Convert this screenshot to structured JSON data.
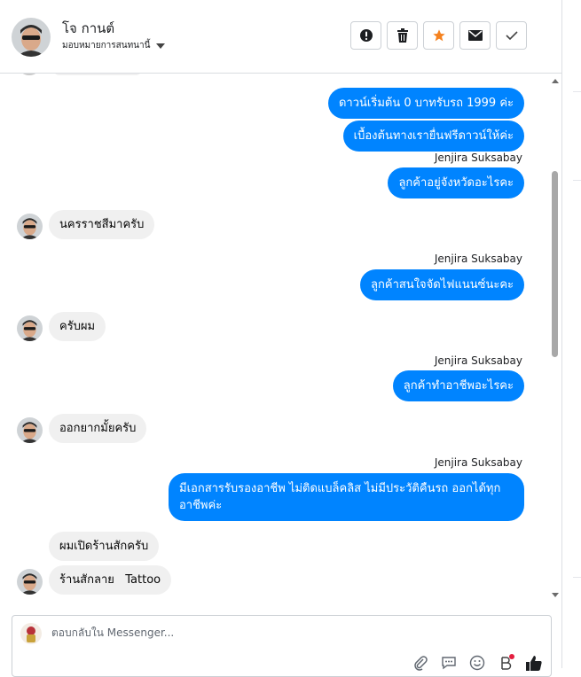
{
  "contact": {
    "name": "โจ กานต์",
    "status_label": "มอบหมายการสนทนานี้"
  },
  "header_actions": [
    {
      "icon": "report-icon",
      "label": "report"
    },
    {
      "icon": "trash-icon",
      "label": "delete"
    },
    {
      "icon": "star-icon",
      "label": "star",
      "color": "#f5821f"
    },
    {
      "icon": "mail-icon",
      "label": "mark unread"
    },
    {
      "icon": "check-icon",
      "label": "done"
    }
  ],
  "messages": [
    {
      "dir": "out",
      "text": "ดาวน์เริ่มต้น 0 บาทรับรถ 1999 ค่ะ"
    },
    {
      "dir": "out",
      "text": "เบื้องต้นทางเรายื่นฟรีดาวน์ให้ค่ะ"
    },
    {
      "dir": "out",
      "sender": "Jenjira Suksabay",
      "text": "ลูกค้าอยู่จังหวัดอะไรคะ"
    },
    {
      "dir": "in",
      "text": "นครราชสีมาครับ"
    },
    {
      "dir": "out",
      "sender": "Jenjira Suksabay",
      "text": "ลูกค้าสนใจจัดไฟแนนซ์นะคะ"
    },
    {
      "dir": "in",
      "text": "ครับผม"
    },
    {
      "dir": "out",
      "sender": "Jenjira Suksabay",
      "text": "ลูกค้าทำอาชีพอะไรคะ"
    },
    {
      "dir": "in",
      "text": "ออกยากมั้ยครับ"
    },
    {
      "dir": "out",
      "sender": "Jenjira Suksabay",
      "text": "มีเอกสารรับรองอาชีพ ไม่ติดแบล็คลิส ไม่มีประวัติคืนรถ ออกได้ทุกอาชีพค่ะ"
    },
    {
      "dir": "in",
      "text": "ผมเปิดร้านสักครับ"
    },
    {
      "dir": "in",
      "text": "ร้านสักลาย   Tattoo"
    }
  ],
  "composer": {
    "placeholder": "ตอบกลับใน Messenger...",
    "tools": [
      "attach-icon",
      "saved-reply-icon",
      "emoji-icon",
      "payment-icon",
      "like-icon"
    ]
  },
  "colors": {
    "outgoing_bubble": "#0084ff",
    "incoming_bubble": "#f0f0f0",
    "star": "#f5821f"
  }
}
